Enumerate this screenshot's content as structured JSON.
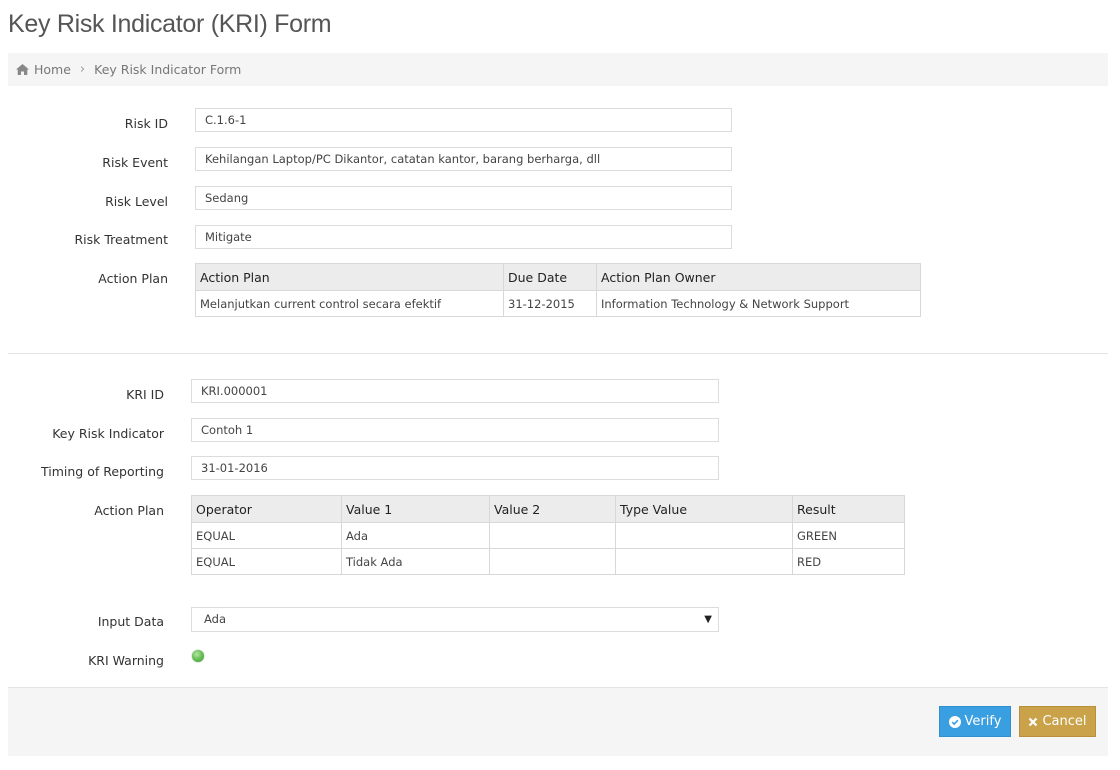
{
  "page": {
    "title": "Key Risk Indicator (KRI) Form"
  },
  "breadcrumb": {
    "home": "Home",
    "current": "Key Risk Indicator Form",
    "icon": "home-icon"
  },
  "risk": {
    "risk_id_label": "Risk ID",
    "risk_id": "C.1.6-1",
    "risk_event_label": "Risk Event",
    "risk_event": "Kehilangan Laptop/PC Dikantor, catatan kantor, barang berharga, dll",
    "risk_level_label": "Risk Level",
    "risk_level": "Sedang",
    "risk_treatment_label": "Risk Treatment",
    "risk_treatment": "Mitigate",
    "action_plan_label": "Action Plan",
    "action_plan_table": {
      "headers": [
        "Action Plan",
        "Due Date",
        "Action Plan Owner"
      ],
      "rows": [
        [
          "Melanjutkan current control secara efektif",
          "31-12-2015",
          "Information Technology & Network Support"
        ]
      ]
    }
  },
  "kri": {
    "kri_id_label": "KRI ID",
    "kri_id": "KRI.000001",
    "indicator_label": "Key Risk Indicator",
    "indicator": "Contoh 1",
    "timing_label": "Timing of Reporting",
    "timing": "31-01-2016",
    "action_plan_label": "Action Plan",
    "threshold_table": {
      "headers": [
        "Operator",
        "Value 1",
        "Value 2",
        "Type Value",
        "Result"
      ],
      "rows": [
        [
          "EQUAL",
          "Ada",
          "",
          "",
          "GREEN"
        ],
        [
          "EQUAL",
          "Tidak Ada",
          "",
          "",
          "RED"
        ]
      ]
    },
    "input_label": "Input Data",
    "input_value": "Ada",
    "warning_label": "KRI Warning",
    "warning_color": "#5cb85c"
  },
  "buttons": {
    "verify": "Verify",
    "cancel": "Cancel"
  },
  "colors": {
    "verify": "#3a9fe0",
    "cancel": "#c9a24a"
  }
}
